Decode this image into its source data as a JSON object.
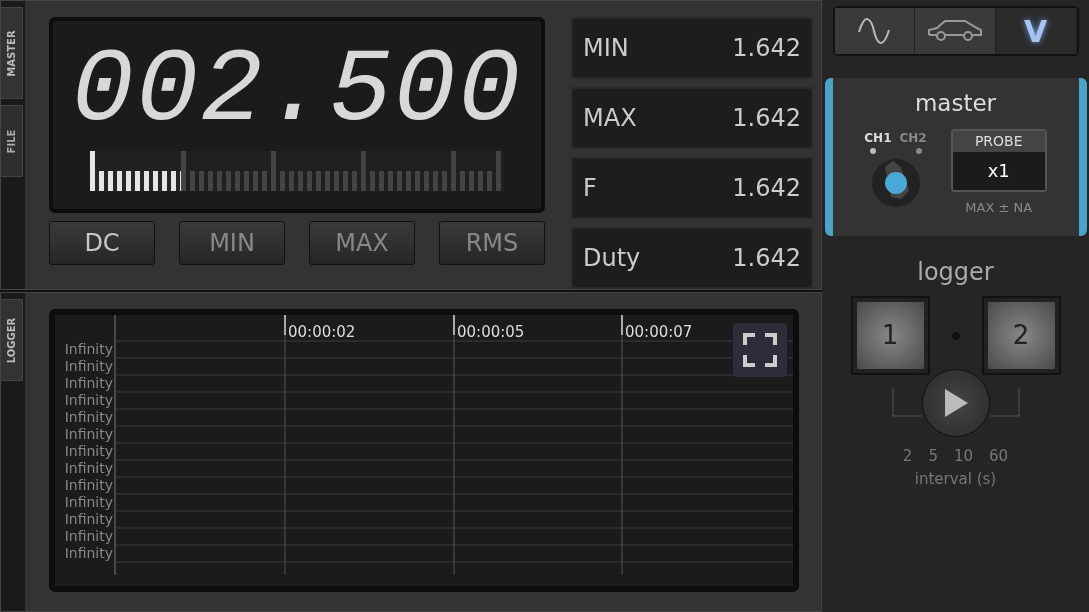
{
  "side_tabs": [
    {
      "label": "MASTER",
      "selected": true
    },
    {
      "label": "FILE",
      "selected": false
    }
  ],
  "display": {
    "reading": "002.500",
    "level": 0.22
  },
  "modes": [
    {
      "label": "DC",
      "selected": true
    },
    {
      "label": "MIN",
      "selected": false
    },
    {
      "label": "MAX",
      "selected": false
    },
    {
      "label": "RMS",
      "selected": false
    }
  ],
  "stats": [
    {
      "label": "MIN",
      "value": "1.642"
    },
    {
      "label": "MAX",
      "value": "1.642"
    },
    {
      "label": "F",
      "value": "1.642"
    },
    {
      "label": "Duty",
      "value": "1.642"
    }
  ],
  "logger_tab": {
    "label": "LOGGER"
  },
  "logger_chart": {
    "x_labels": [
      "00:00:02",
      "00:00:05",
      "00:00:07"
    ],
    "y_labels": [
      "Infinity",
      "Infinity",
      "Infinity",
      "Infinity",
      "Infinity",
      "Infinity",
      "Infinity",
      "Infinity",
      "Infinity",
      "Infinity",
      "Infinity",
      "Infinity",
      "Infinity"
    ]
  },
  "top_tabs": [
    {
      "kind": "wave",
      "selected": false
    },
    {
      "kind": "car",
      "selected": false
    },
    {
      "kind": "text",
      "label": "V",
      "selected": true
    }
  ],
  "master": {
    "title": "master",
    "channels": [
      {
        "label": "CH1",
        "selected": true
      },
      {
        "label": "CH2",
        "selected": false
      }
    ],
    "probe_label": "PROBE",
    "probe_value": "x1",
    "note": "MAX ± NA"
  },
  "logger": {
    "title": "logger",
    "buttons": [
      "1",
      "2"
    ]
  },
  "interval": {
    "labels": [
      "2",
      "5",
      "10",
      "60"
    ],
    "title": "interval (s)"
  }
}
